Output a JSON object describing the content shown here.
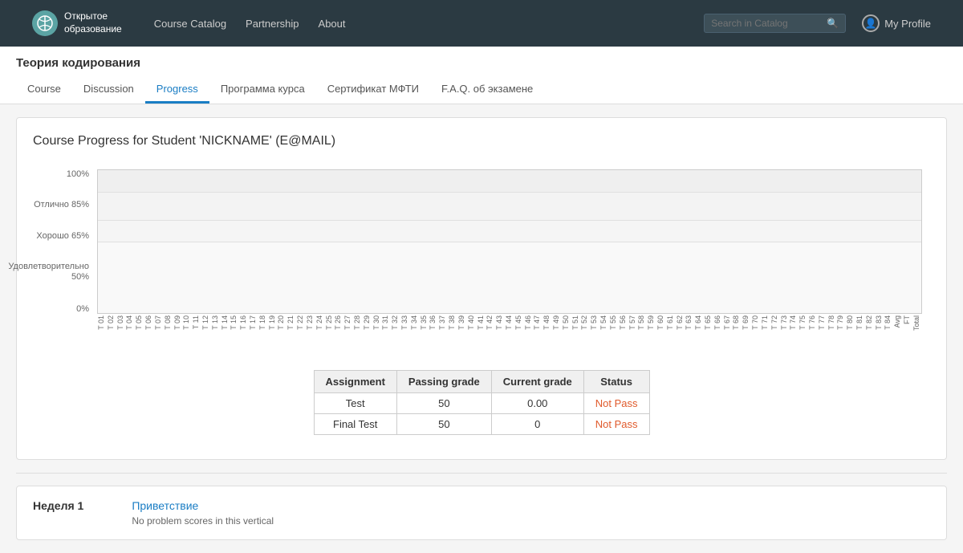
{
  "navbar": {
    "brand": {
      "line1": "Открытое",
      "line2": "образование"
    },
    "links": [
      {
        "label": "Course Catalog",
        "href": "#"
      },
      {
        "label": "Partnership",
        "href": "#"
      },
      {
        "label": "About",
        "href": "#"
      }
    ],
    "search_placeholder": "Search in Catalog",
    "profile_label": "My Profile"
  },
  "course": {
    "title": "Теория кодирования",
    "tabs": [
      {
        "label": "Course",
        "active": false
      },
      {
        "label": "Discussion",
        "active": false
      },
      {
        "label": "Progress",
        "active": true
      },
      {
        "label": "Программа курса",
        "active": false
      },
      {
        "label": "Сертификат МФТИ",
        "active": false
      },
      {
        "label": "F.A.Q. об экзамене",
        "active": false
      }
    ]
  },
  "progress": {
    "heading": "Course Progress for Student 'NICKNAME' (E@MAIL)",
    "chart": {
      "y_labels": [
        "100%",
        "Отлично 85%",
        "Хорошо 65%",
        "Удовлетворительно\n50%",
        "0%"
      ],
      "x_labels": [
        "T 01",
        "T 02",
        "T 03",
        "T 04",
        "T 05",
        "T 06",
        "T 07",
        "T 08",
        "T 09",
        "T 10",
        "T 11",
        "T 12",
        "T 13",
        "T 14",
        "T 15",
        "T 16",
        "T 17",
        "T 18",
        "T 19",
        "T 20",
        "T 21",
        "T 22",
        "T 23",
        "T 24",
        "T 25",
        "T 26",
        "T 27",
        "T 28",
        "T 29",
        "T 30",
        "T 31",
        "T 32",
        "T 33",
        "T 34",
        "T 35",
        "T 36",
        "T 37",
        "T 38",
        "T 39",
        "T 40",
        "T 41",
        "T 42",
        "T 43",
        "T 44",
        "T 45",
        "T 46",
        "T 47",
        "T 48",
        "T 49",
        "T 50",
        "T 51",
        "T 52",
        "T 53",
        "T 54",
        "T 55",
        "T 56",
        "T 57",
        "T 58",
        "T 59",
        "T 60",
        "T 61",
        "T 62",
        "T 63",
        "T 64",
        "T 65",
        "T 66",
        "T 67",
        "T 68",
        "T 69",
        "T 70",
        "T 71",
        "T 72",
        "T 73",
        "T 74",
        "T 75",
        "T 76",
        "T 77",
        "T 78",
        "T 79",
        "T 80",
        "T 81",
        "T 82",
        "T 83",
        "T 84",
        "Avg",
        "FT",
        "Total"
      ]
    },
    "grade_table": {
      "headers": [
        "Assignment",
        "Passing grade",
        "Current grade",
        "Status"
      ],
      "rows": [
        {
          "assignment": "Test",
          "passing_grade": "50",
          "current_grade": "0.00",
          "status": "Not Pass"
        },
        {
          "assignment": "Final Test",
          "passing_grade": "50",
          "current_grade": "0",
          "status": "Not Pass"
        }
      ]
    }
  },
  "week1": {
    "label": "Неделя 1",
    "link_label": "Приветствие",
    "no_scores_text": "No problem scores in this vertical"
  }
}
